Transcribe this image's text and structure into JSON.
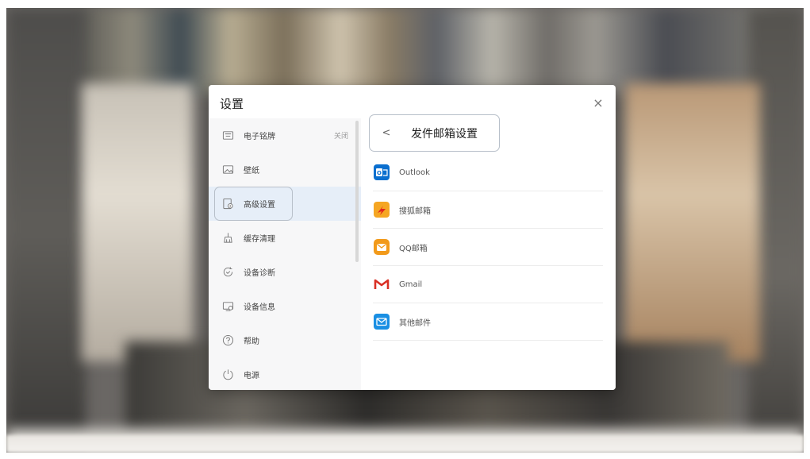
{
  "dialog": {
    "title": "设置",
    "close_glyph": "×"
  },
  "sidebar": {
    "items": [
      {
        "label": "电子铭牌",
        "state": "关闭",
        "icon": "nameplate-icon"
      },
      {
        "label": "壁纸",
        "icon": "wallpaper-icon"
      },
      {
        "label": "高级设置",
        "icon": "advanced-settings-icon",
        "active": true
      },
      {
        "label": "缓存清理",
        "icon": "cache-clean-icon"
      },
      {
        "label": "设备诊断",
        "icon": "diagnosis-icon"
      },
      {
        "label": "设备信息",
        "icon": "device-info-icon"
      },
      {
        "label": "帮助",
        "icon": "help-icon"
      },
      {
        "label": "电源",
        "icon": "power-icon"
      }
    ]
  },
  "panel": {
    "back_glyph": "<",
    "title": "发件邮箱设置",
    "providers": [
      {
        "label": "Outlook",
        "icon": "outlook-icon",
        "color": "#0a6fcf"
      },
      {
        "label": "搜狐邮箱",
        "icon": "sohu-mail-icon",
        "color": "#f5a623"
      },
      {
        "label": "QQ邮箱",
        "icon": "qq-mail-icon",
        "color": "#f29a1a"
      },
      {
        "label": "Gmail",
        "icon": "gmail-icon",
        "color": "#d93025"
      },
      {
        "label": "其他邮件",
        "icon": "other-mail-icon",
        "color": "#1a8fe3"
      }
    ]
  },
  "colors": {
    "active_bg": "#e6eef8",
    "highlight_border": "#b7bfc9"
  }
}
